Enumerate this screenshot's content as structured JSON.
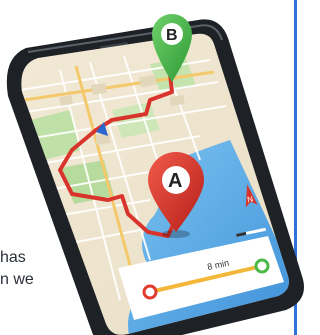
{
  "illustration": {
    "pin_a_label": "A",
    "pin_b_label": "B",
    "route_time": "8 min",
    "compass_letter": "N"
  },
  "article": {
    "text_fragment_line1": "has",
    "text_fragment_line2": "n we"
  },
  "colors": {
    "route": "#d9342b",
    "pin_a": "#e23c2f",
    "pin_b": "#4cb848",
    "sea": "#5aa9e6",
    "accent_rule": "#2d73d8"
  }
}
